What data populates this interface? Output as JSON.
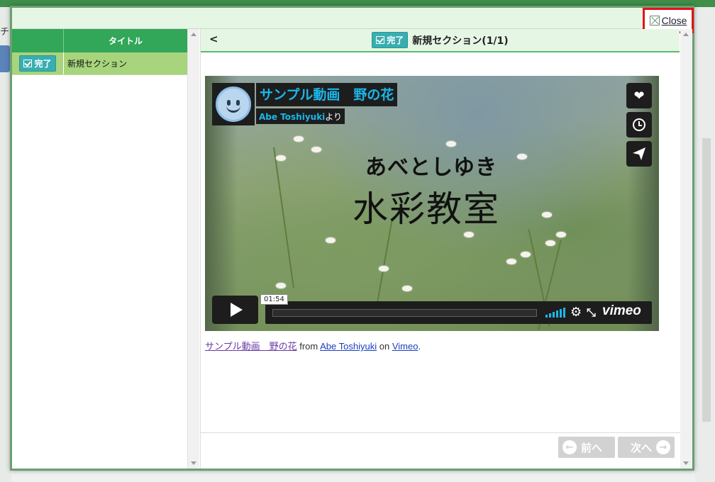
{
  "background": {
    "left_char": "チ"
  },
  "modal": {
    "close_label": "Close"
  },
  "list": {
    "header_title": "タイトル",
    "rows": [
      {
        "status": "完了",
        "title": "新規セクション"
      }
    ]
  },
  "content": {
    "back_label": "<",
    "status": "完了",
    "section_title": "新規セクション(1/1)"
  },
  "video": {
    "title": "サンプル動画　野の花",
    "by_user": "Abe Toshiyuki",
    "by_suffix": "より",
    "poster_subtitle": "あべとしゆき",
    "poster_title": "水彩教室",
    "time": "01:54",
    "logo": "vimeo"
  },
  "caption": {
    "video_link": "サンプル動画　野の花",
    "from": " from ",
    "user_link": "Abe Toshiyuki",
    "on": " on ",
    "site_link": "Vimeo",
    "end": "."
  },
  "footer": {
    "prev_label": "前へ",
    "next_label": "次へ"
  },
  "colors": {
    "accent": "#32a659",
    "close_highlight": "#e5121b",
    "vimeo_blue": "#1ab7ea"
  }
}
